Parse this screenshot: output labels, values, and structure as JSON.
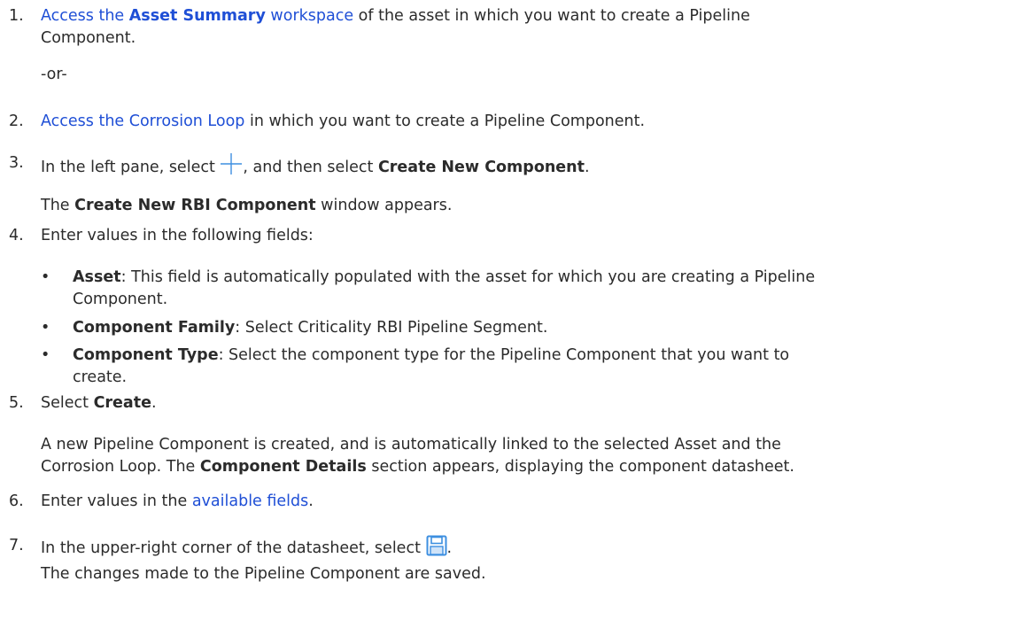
{
  "steps": [
    {
      "num": "1.",
      "link_part1": "Access the ",
      "link_bold": "Asset Summary",
      "link_part2": " workspace",
      "rest_line1": " of the asset in which you want to create a Pipeline",
      "line2": "Component."
    },
    {
      "or": "-or-"
    },
    {
      "num": "2.",
      "link": "Access the Corrosion Loop",
      "rest": " in which you want to create a Pipeline Component."
    },
    {
      "num": "3.",
      "pre": "In the left pane, select ",
      "mid": ", and then select ",
      "bold": "Create New Component",
      "end": ".",
      "icon": "plus-icon",
      "note_pre": "The ",
      "note_bold": "Create New RBI Component",
      "note_post": " window appears."
    },
    {
      "num": "4.",
      "text": "Enter values in the following fields:",
      "bullets": [
        {
          "mark": "•",
          "label": "Asset",
          "line1": ": This field is automatically populated with the asset for which you are creating a Pipeline",
          "line2": "Component."
        },
        {
          "mark": "•",
          "label": "Component Family",
          "line1": ": Select Criticality RBI Pipeline Segment."
        },
        {
          "mark": "•",
          "label": "Component Type",
          "line1": ": Select the component type for the Pipeline Component that you want to",
          "line2": "create."
        }
      ]
    },
    {
      "num": "5.",
      "pre": "Select ",
      "bold": "Create",
      "end": ".",
      "note_line1": "A new Pipeline Component is created, and is automatically linked to the selected Asset and the",
      "note_line2_pre": "Corrosion Loop. The ",
      "note_line2_bold": "Component Details",
      "note_line2_post": " section appears, displaying the component datasheet."
    },
    {
      "num": "6.",
      "pre": "Enter values in the ",
      "link": "available fields",
      "end": "."
    },
    {
      "num": "7.",
      "pre": "In the upper-right corner of the datasheet, select ",
      "end": ".",
      "icon": "save-icon",
      "line2": "The changes made to the Pipeline Component are saved."
    }
  ],
  "colors": {
    "link": "#1f4fd6",
    "text": "#2b2b2b",
    "icon": "#3d8fe0"
  }
}
